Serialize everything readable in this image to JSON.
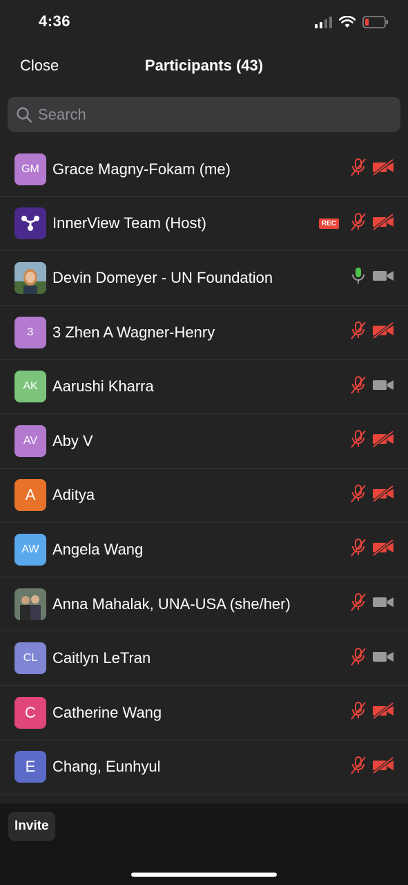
{
  "status_bar": {
    "time": "4:36"
  },
  "nav": {
    "close_label": "Close",
    "title": "Participants (43)"
  },
  "search": {
    "placeholder": "Search"
  },
  "participants": [
    {
      "initials": "GM",
      "name": "Grace Magny-Fokam (me)",
      "avatar_color": "#b47ad0",
      "mic": "muted",
      "video": "off",
      "rec": ""
    },
    {
      "initials": "",
      "name": "InnerView Team (Host)",
      "avatar_color": "#4a2a8c",
      "avatar_type": "logo",
      "mic": "muted",
      "video": "off",
      "rec": "REC"
    },
    {
      "initials": "",
      "name": "Devin Domeyer - UN Foundation",
      "avatar_color": "#6a8a9c",
      "avatar_type": "photo",
      "mic": "on",
      "video": "on-gray",
      "rec": ""
    },
    {
      "initials": "3",
      "name": "3 Zhen A Wagner-Henry",
      "avatar_color": "#b47ad0",
      "mic": "muted",
      "video": "off",
      "rec": ""
    },
    {
      "initials": "AK",
      "name": "Aarushi Kharra",
      "avatar_color": "#7cc47c",
      "mic": "muted",
      "video": "on-gray",
      "rec": ""
    },
    {
      "initials": "AV",
      "name": "Aby V",
      "avatar_color": "#b47ad0",
      "mic": "muted",
      "video": "off",
      "rec": ""
    },
    {
      "initials": "A",
      "name": "Aditya",
      "avatar_color": "#e8722a",
      "mic": "muted",
      "video": "off",
      "rec": ""
    },
    {
      "initials": "AW",
      "name": "Angela Wang",
      "avatar_color": "#5aa8ec",
      "mic": "muted",
      "video": "off",
      "rec": ""
    },
    {
      "initials": "",
      "name": "Anna Mahalak, UNA-USA (she/her)",
      "avatar_color": "#5a5a4a",
      "avatar_type": "photo",
      "mic": "muted",
      "video": "on-gray",
      "rec": ""
    },
    {
      "initials": "CL",
      "name": "Caitlyn LeTran",
      "avatar_color": "#7f86d4",
      "mic": "muted",
      "video": "on-gray",
      "rec": ""
    },
    {
      "initials": "C",
      "name": "Catherine Wang",
      "avatar_color": "#e0457c",
      "mic": "muted",
      "video": "off",
      "rec": ""
    },
    {
      "initials": "E",
      "name": "Chang, Eunhyul",
      "avatar_color": "#5c6bc8",
      "mic": "muted",
      "video": "off",
      "rec": ""
    }
  ],
  "footer": {
    "invite_label": "Invite"
  },
  "colors": {
    "muted_red": "#e8453c",
    "mic_green": "#4cc34c",
    "icon_gray": "#9a9a9a"
  }
}
